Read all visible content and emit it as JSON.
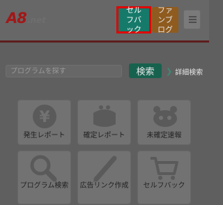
{
  "header": {
    "logo_main": "A8",
    "logo_sub": ".net",
    "selfback_label": "セルフバック",
    "fanblog_label": "ファンブログ",
    "menu_icon": "hamburger-menu-icon"
  },
  "search": {
    "placeholder": "プログラムを探す",
    "button_label": "検索",
    "detail_label": "詳細検索"
  },
  "tiles": [
    {
      "label": "発生レポート",
      "icon": "yen-icon"
    },
    {
      "label": "確定レポート",
      "icon": "wallet-icon"
    },
    {
      "label": "未確定速報",
      "icon": "robot-icon"
    },
    {
      "label": "プログラム検索",
      "icon": "magnifier-icon"
    },
    {
      "label": "広告リンク作成",
      "icon": "pencil-icon"
    },
    {
      "label": "セルフバック",
      "icon": "cart-icon"
    }
  ],
  "colors": {
    "accent_teal": "#167a6a",
    "highlight_red": "#e10000",
    "brand_red": "#a31717"
  }
}
